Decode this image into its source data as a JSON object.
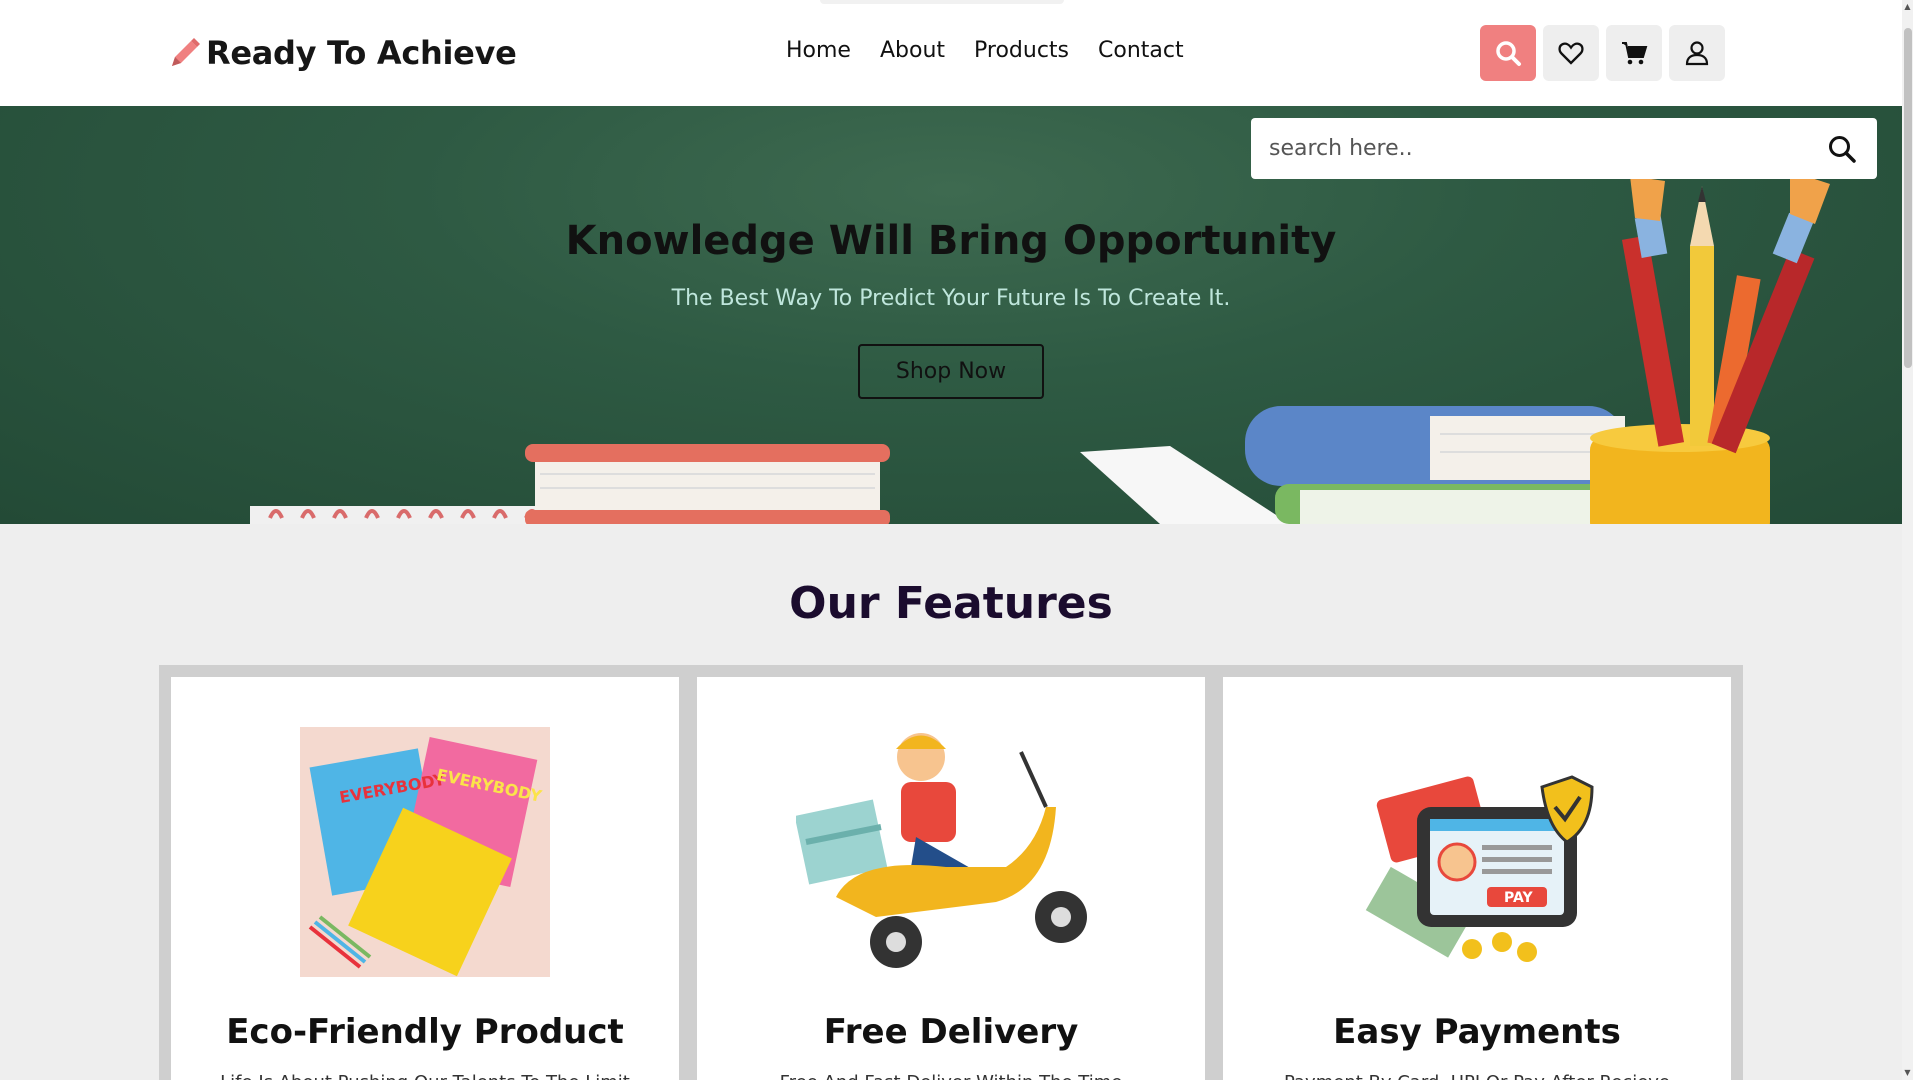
{
  "brand": {
    "name": "Ready To Achieve",
    "icon": "pencil-icon",
    "accent": "#f08080"
  },
  "nav": {
    "items": [
      "Home",
      "About",
      "Products",
      "Contact"
    ]
  },
  "header_icons": [
    "search-icon",
    "heart-icon",
    "cart-icon",
    "user-icon"
  ],
  "search": {
    "placeholder": "search here.."
  },
  "hero": {
    "title": "Knowledge Will Bring Opportunity",
    "subtitle": "The Best Way To Predict Your Future Is To Create It.",
    "button": "Shop Now",
    "background": "#2e5a43"
  },
  "features": {
    "title": "Our Features",
    "cards": [
      {
        "title": "Eco-Friendly Product",
        "text": "Life Is About Pushing Our Talents To The Limit",
        "image": "books-image"
      },
      {
        "title": "Free Delivery",
        "text": "Free And Fast Deliver Within The Time",
        "image": "delivery-scooter-image"
      },
      {
        "title": "Easy Payments",
        "text": "Payment By Card, UPI Or Pay After Recieve",
        "image": "payment-card-image"
      }
    ]
  }
}
